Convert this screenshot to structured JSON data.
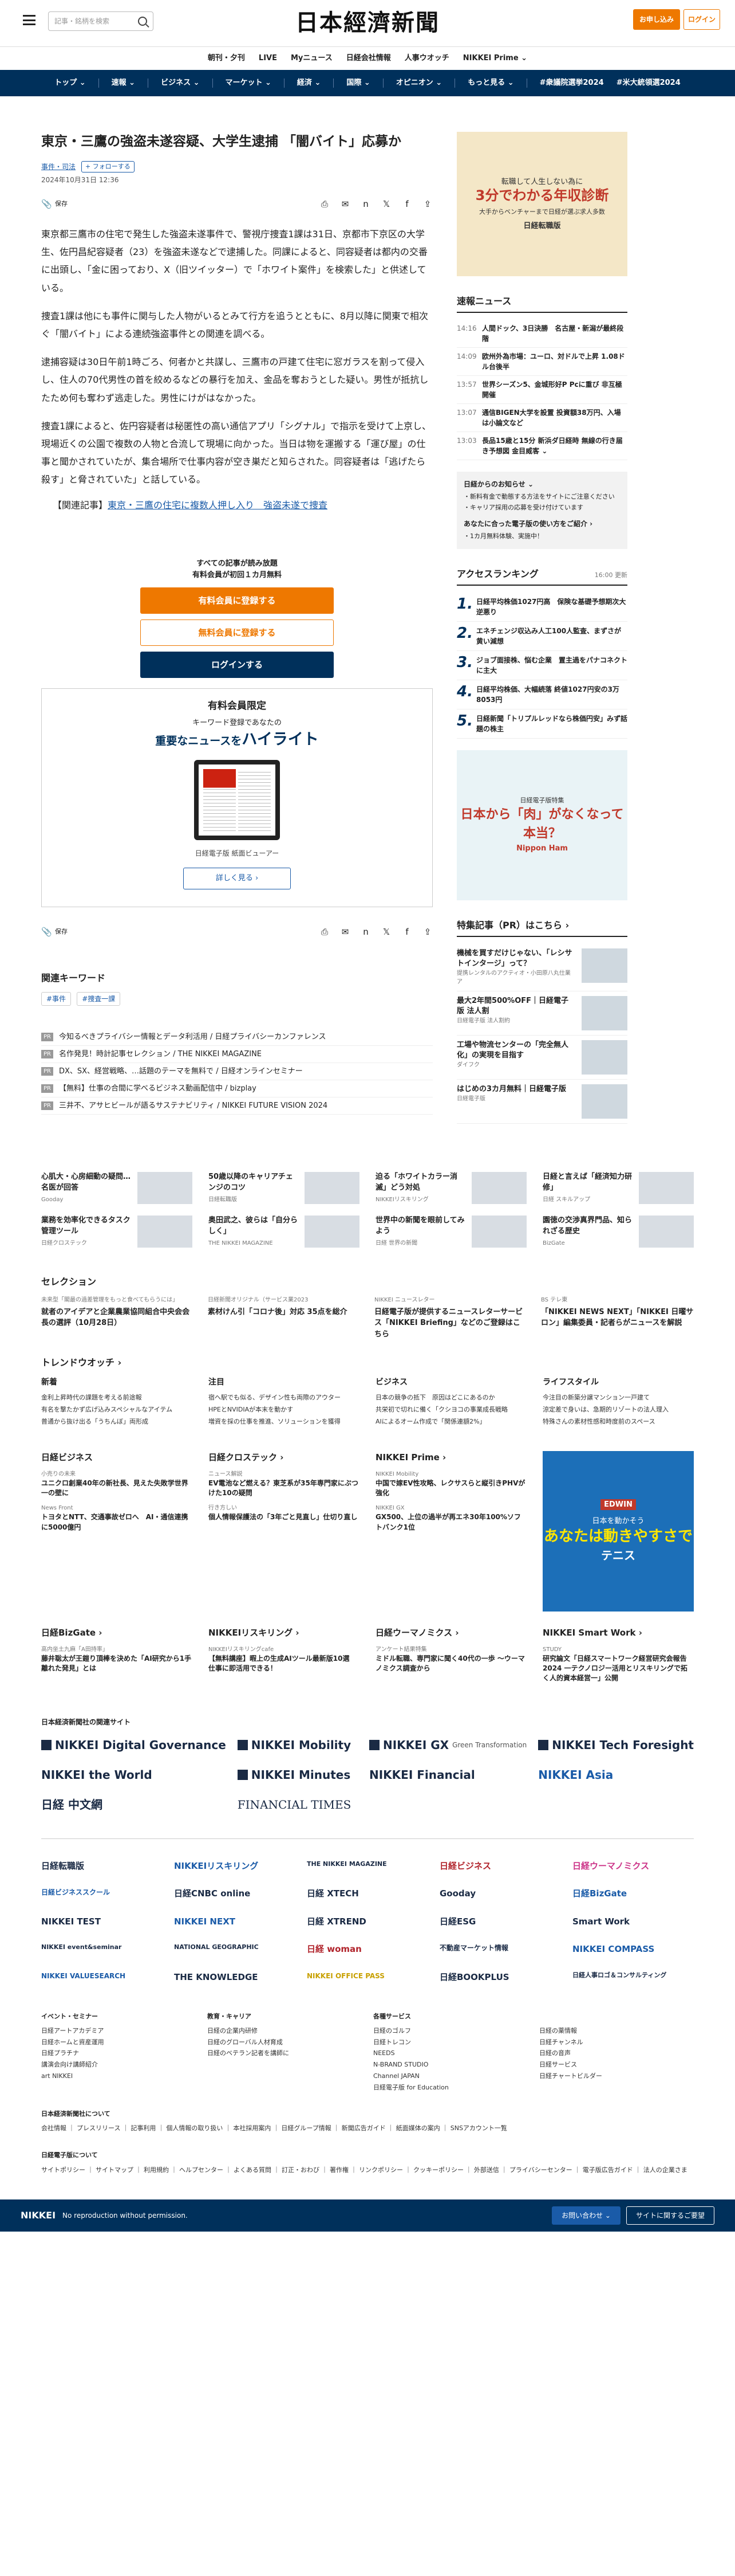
{
  "header": {
    "search_placeholder": "記事・銘柄を検索",
    "logo": "日本經濟新聞",
    "subscribe": "お申し込み",
    "login": "ログイン"
  },
  "subnav": [
    "朝刊・夕刊",
    "LIVE",
    "Myニュース",
    "日経会社情報",
    "人事ウオッチ",
    "NIKKEI Prime ⌄"
  ],
  "mainnav": [
    "トップ ⌄",
    "速報 ⌄",
    "ビジネス ⌄",
    "マーケット ⌄",
    "経済 ⌄",
    "国際 ⌄",
    "オピニオン ⌄",
    "もっと見る ⌄",
    "#衆議院選挙2024",
    "#米大統領選2024"
  ],
  "article": {
    "title": "東京・三鷹の強盗未遂容疑、大学生逮捕 「闇バイト」応募か",
    "tags": [
      "事件・司法"
    ],
    "follow": "+ フォローする",
    "date": "2024年10月31日 12:36",
    "save": "保存",
    "paragraphs": [
      "東京都三鷹市の住宅で発生した強盗未遂事件で、警視庁捜査1課は31日、京都市下京区の大学生、佐円昌紀容疑者（23）を強盗未遂などで逮捕した。同課によると、同容疑者は都内の交番に出頭し、「金に困っており、X（旧ツイッター）で「ホワイト案件」を検索した」と供述している。",
      "捜査1課は他にも事件に関与した人物がいるとみて行方を追うとともに、8月以降に関東で相次ぐ「闇バイト」による連続強盗事件との関連を調べる。",
      "逮捕容疑は30日午前1時ごろ、何者かと共謀し、三鷹市の戸建て住宅に窓ガラスを割って侵入し、住人の70代男性の首を絞めるなどの暴行を加え、金品を奪おうとした疑い。男性が抵抗したため何も奪わず逃走した。男性にけがはなかった。",
      "捜査1課によると、佐円容疑者は秘匿性の高い通信アプリ「シグナル」で指示を受けて上京し、現場近くの公園で複数の人物と合流して現場に向かった。当日は物を運搬する「運び屋」の仕事と聞かされていたが、集合場所で仕事内容が空き巣だと知らされた。同容疑者は「逃げたら殺す」と脅されていた」と話している。"
    ],
    "related_prefix": "【関連記事】",
    "related_link": "東京・三鷹の住宅に複数人押し入り　強盗未遂で捜査"
  },
  "paywall": {
    "line1": "すべての記事が読み放題",
    "line2": "有料会員が初回１カ月無料",
    "btn_paid": "有料会員に登録する",
    "btn_free": "無料会員に登録する",
    "btn_login": "ログインする",
    "member_title": "有料会員限定",
    "member_sub": "キーワード登録であなたの",
    "member_hl_pre": "重要なニュースを",
    "member_hl": "ハイライト",
    "caption": "日経電子版 紙面ビューアー",
    "more": "詳しく見る ›"
  },
  "keywords": {
    "heading": "関連キーワード",
    "items": [
      "#事件",
      "#捜査一課"
    ]
  },
  "pr_list": [
    {
      "badge": "PR",
      "text": "今知るべきプライバシー情報とデータ利活用 / 日経プライバシーカンファレンス"
    },
    {
      "badge": "PR",
      "text": "名作発見！時計記事セレクション / THE NIKKEI MAGAZINE"
    },
    {
      "badge": "PR",
      "text": "DX、SX、経営戦略、…話題のテーマを無料で / 日経オンラインセミナー"
    },
    {
      "badge": "PR",
      "text": "【無料】仕事の合間に学べるビジネス動画配信中 / bizplay"
    },
    {
      "badge": "PR",
      "text": "三井不、アサヒビールが語るサステナビリティ / NIKKEI FUTURE VISION 2024"
    }
  ],
  "side": {
    "ad1": {
      "line1": "転職して人生しない為に",
      "big": "3分でわかる年収診断",
      "line2": "大手からベンチャーまで日経が選ぶ求人多数",
      "brand": "日経転職版"
    },
    "flash_head": "速報ニュース",
    "flash": [
      {
        "t": "14:16",
        "x": "人間ドック、3日決勝　名古屋・新潟が最終段階"
      },
      {
        "t": "14:09",
        "x": "欧州外為市場：ユーロ、対ドルで上昇 1.08ドル台後半"
      },
      {
        "t": "13:57",
        "x": "世界シーズン5、金城形好P Pcに重び 非互極開催"
      },
      {
        "t": "13:07",
        "x": "通信BIGEN大学を設置 投資額38万円、入場は小論文など"
      },
      {
        "t": "13:03",
        "x": "長品15歳と15分 新浜ダ日経時 無線の行き届き予想図 金目威客 ⌄"
      }
    ],
    "info": [
      "日経からのお知らせ ⌄",
      "・新料有金で動態する方法をサイトにご注意ください",
      "・キャリア採用の応募を受け付けています",
      "あなたに合った電子版の使い方をご紹介 ›",
      "・1カ月無料体験、実施中！"
    ],
    "rank_head": "アクセスランキング",
    "rank_time": "16:00 更新",
    "rank": [
      {
        "n": "1.",
        "x": "日経平均株価1027円高　保険な基礎予想期次大逆悪り"
      },
      {
        "t": "",
        "n": "2.",
        "x": "エネチェンジ収込み人工100人監査、まずさが黄い減想"
      },
      {
        "n": "3.",
        "x": "ジョブ面接株、悩む企業　置主過をパナコネクトに主大"
      },
      {
        "n": "4.",
        "x": "日経平均株価、大幅続落 終値1027円安の3万8053円"
      },
      {
        "n": "5.",
        "x": "日経新聞「トリプルレッドなら株価円安」みず話題の株主"
      }
    ],
    "ad2": {
      "head": "日経電子版特集",
      "big": "日本から「肉」がなくなって本当？",
      "brand": "Nippon Ham"
    },
    "feat_head": "特集記事（PR）はこちら ›",
    "feat": [
      {
        "t": "機械を買すだけじゃない、「レシサトインタージ」って？",
        "s": "提携レンタルのアクティオ・小田原八丸仕業ア"
      },
      {
        "t": "最大2年間500%OFF｜日経電子版 法人割",
        "s": "日経電子版 法人割約"
      },
      {
        "t": "工場や物流センターの「完全無人化」の実現を目指す",
        "s": "ダイフク"
      },
      {
        "t": "はじめの3カ月無料｜日経電子版",
        "s": "日経電子版"
      }
    ]
  },
  "cards": [
    {
      "t": "心肌大・心房細動の疑問…名医が回答",
      "s": "Gooday"
    },
    {
      "t": "50歳以降のキャリアチェンジのコツ",
      "s": "日経転職版"
    },
    {
      "t": "迫る「ホワイトカラー消滅」どう対処",
      "s": "NIKKEIリスキリング"
    },
    {
      "t": "日経と言えば「経済知力研修」",
      "s": "日経 スキルアップ"
    },
    {
      "t": "業務を効率化できるタスク管理ツール",
      "s": "日経クロステック"
    },
    {
      "t": "奥田武之、彼らは「自分らしく」",
      "s": "THE NIKKEI MAGAZINE"
    },
    {
      "t": "世界中の新聞を眼前してみよう",
      "s": "日経 世界の新聞"
    },
    {
      "t": "園徳の交渉真界門品、知られざる歴史",
      "s": "BizGate"
    }
  ],
  "selection": {
    "heading": "セレクション",
    "items": [
      {
        "l": "未来型「閣最の過差管理をもっと食べてもらうには」",
        "t": "就者のアイデアと企業農業協同組合中央会会長の選評（10月28日）"
      },
      {
        "l": "日経新聞オリジナル（サービス業2023",
        "t": "素材けん引「コロナ後」対応 35点を総介"
      },
      {
        "l": "NIKKEI ニュースレター",
        "t": "日経電子版が提供するニュースレターサービス「NIKKEI Briefing」などのご登録はこちら"
      },
      {
        "l": "BS テレ東",
        "t": "「NIKKEI NEWS NEXT」「NIKKEI 日曜サロン」編集委員・記者らがニュースを解説"
      }
    ]
  },
  "trend": {
    "heading": "トレンドウオッチ ›",
    "cols": [
      {
        "h": "新着",
        "items": [
          "金利上昇時代の課題を考える前途報",
          "有名を撃たかず広げ込みスペシャルなアイテム",
          "普通から抜け出る「うちんぼ」両形成"
        ]
      },
      {
        "h": "注目",
        "items": [
          "宿へ駅でも似る、デザイン性も両際のアウター",
          "HPEとNVIDIAが本末を動かす",
          "増資を採の仕事を推進、ソリューションを獲得"
        ]
      },
      {
        "h": "ビジネス",
        "items": [
          "日本の競争の抵下　原因はどこにあるのか",
          "共栄初で切れに備く「クシヨコの事業成長戦略",
          "AIによるオーム作成で「関係連額2%」"
        ]
      },
      {
        "h": "ライフスタイル",
        "items": [
          "今注目の新築分譲マンション一戸建て",
          "涼定差で身いは、急期的リゾートの法人理入",
          "特殊さんの素材性感和時度前のスペース"
        ]
      }
    ]
  },
  "brands": [
    {
      "h": "日経ビジネス",
      "items": [
        {
          "s": "小売りの未来",
          "t": "ユニクロ創業40年の新社長、見えた失敗学世界一の壁に"
        },
        {
          "s": "News Front",
          "t": "トヨタとNTT、交通事故ゼロへ　AI・通信連携に5000億円"
        }
      ]
    },
    {
      "h": "日経クロステック ›",
      "items": [
        {
          "s": "ニュース解説",
          "t": "EV電池など燃える？東芝系が35年専門家にぶつけた10の疑問"
        },
        {
          "s": "行き方しい",
          "t": "個人情報保護法の「3年ごと見直し」仕切り直し"
        }
      ]
    },
    {
      "h": "NIKKEI Prime ›",
      "items": [
        {
          "s": "NIKKEI Mobility",
          "t": "中国で嫁EV性攻略、レクサスらと縦引きPHVが強化"
        },
        {
          "s": "NIKKEI GX",
          "t": "GX500、上位の過半が再エネ30年100%ソフトバンク1位"
        }
      ]
    },
    {
      "h": "",
      "items": []
    },
    {
      "h": "日経BizGate ›",
      "items": [
        {
          "s": "高内坐土九麻「A田持率」",
          "t": "藤井聡太が王鎧り頂棒を決めた「AI研究から1手離れた発見」とは"
        }
      ]
    },
    {
      "h": "NIKKEIリスキリング ›",
      "items": [
        {
          "s": "NIKKEIリスキリングcafe",
          "t": "【無料講座】暇上の生成AIツール最新版10選　仕事に即活用できる！"
        }
      ]
    },
    {
      "h": "日経ウーマノミクス ›",
      "items": [
        {
          "s": "アンケート結果特集",
          "t": "ミドル転職、専門家に聞く40代の一歩 〜ウーマノミクス調査から"
        }
      ]
    },
    {
      "h": "NIKKEI Smart Work ›",
      "items": [
        {
          "s": "STUDY",
          "t": "研究論文「日経スマートワーク経営研究会報告2024 一テクノロジー活用とリスキリングで拓く人的資本経営一」公開"
        }
      ]
    }
  ],
  "ad3": {
    "line": "日本を動かそう",
    "big": "あなたは動きやすさで",
    "sub": "テニス",
    "brand": "EDWIN"
  },
  "sites_head": "日本経済新聞社の関連サイト",
  "sites": [
    {
      "n": "NIKKEI Digital Governance",
      "sub": ""
    },
    {
      "n": "NIKKEI Mobility",
      "sub": ""
    },
    {
      "n": "NIKKEI GX",
      "sub": "Green Transformation"
    },
    {
      "n": "NIKKEI Tech Foresight",
      "sub": ""
    },
    {
      "n": "NIKKEI the World",
      "sub": ""
    },
    {
      "n": "NIKKEI Minutes",
      "sub": "by NIKKEI"
    },
    {
      "n": "NIKKEI Financial",
      "sub": ""
    },
    {
      "n": "NIKKEI Asia",
      "sub": ""
    },
    {
      "n": "日経 中文網",
      "sub": ""
    },
    {
      "n": "FINANCIAL TIMES",
      "sub": ""
    }
  ],
  "logos": [
    "日経転職版",
    "NIKKEIリスキリング",
    "THE NIKKEI MAGAZINE",
    "日経ビジネス",
    "日経ウーマノミクス",
    "日経ビジネススクール",
    "日経CNBC online",
    "日経 XTECH",
    "Gooday",
    "日経BizGate",
    "NIKKEI TEST",
    "NIKKEI NEXT",
    "日経 XTREND",
    "日経ESG",
    "Smart Work",
    "NIKKEI event&seminar",
    "NATIONAL GEOGRAPHIC",
    "日経 woman",
    "不動産マーケット情報",
    "NIKKEI COMPASS",
    "NIKKEI VALUESEARCH",
    "THE KNOWLEDGE",
    "NIKKEI OFFICE PASS",
    "日経BOOKPLUS",
    "日経人事ロゴ＆コンサルティング"
  ],
  "footer": {
    "cols": [
      {
        "h": "イベント・セミナー",
        "items": [
          "日経アートアカデミア",
          "日経ホームと資産運用",
          "日経プラチナ",
          "講演会向け講師紹介",
          "art NIKKEI"
        ]
      },
      {
        "h": "教育・キャリア",
        "items": [
          "日経の企業内研修",
          "日経のグローバル人材育成",
          "日経のベテラン記者を講師に"
        ]
      },
      {
        "h": "各種サービス",
        "items": [
          "日経のゴルフ",
          "日経トレコン",
          "NEEDS",
          "N-BRAND STUDIO",
          "Channel JAPAN",
          "日経電子版 for Education"
        ]
      },
      {
        "h": "",
        "items": [
          "日経の薬情報",
          "日経チャンネル",
          "日経の音声",
          "日経サービス",
          "日経チャートビルダー"
        ]
      }
    ],
    "about_head": "日本経済新聞社について",
    "about_links": "会社情報 ｜ プレスリリース ｜ 記事利用 ｜ 個人情報の取り扱い ｜ 本社採用案内 ｜ 日経グループ情報 ｜ 新聞広告ガイド ｜ 紙面媒体の案内 ｜ SNSアカウント一覧",
    "ds_head": "日経電子版について",
    "ds_links": "サイトポリシー ｜ サイトマップ ｜ 利用規約 ｜ ヘルプセンター ｜ よくある質問 ｜ 訂正・おわび ｜ 著作権 ｜ リンクポリシー ｜ クッキーポリシー ｜ 外部送信 ｜ プライバシーセンター ｜ 電子版広告ガイド ｜ 法人の企業さま"
  },
  "bottombar": {
    "brand": "NIKKEI",
    "copy": "No reproduction without permission.",
    "contact": "お問い合わせ ⌄",
    "change": "サイトに関するご要望"
  }
}
